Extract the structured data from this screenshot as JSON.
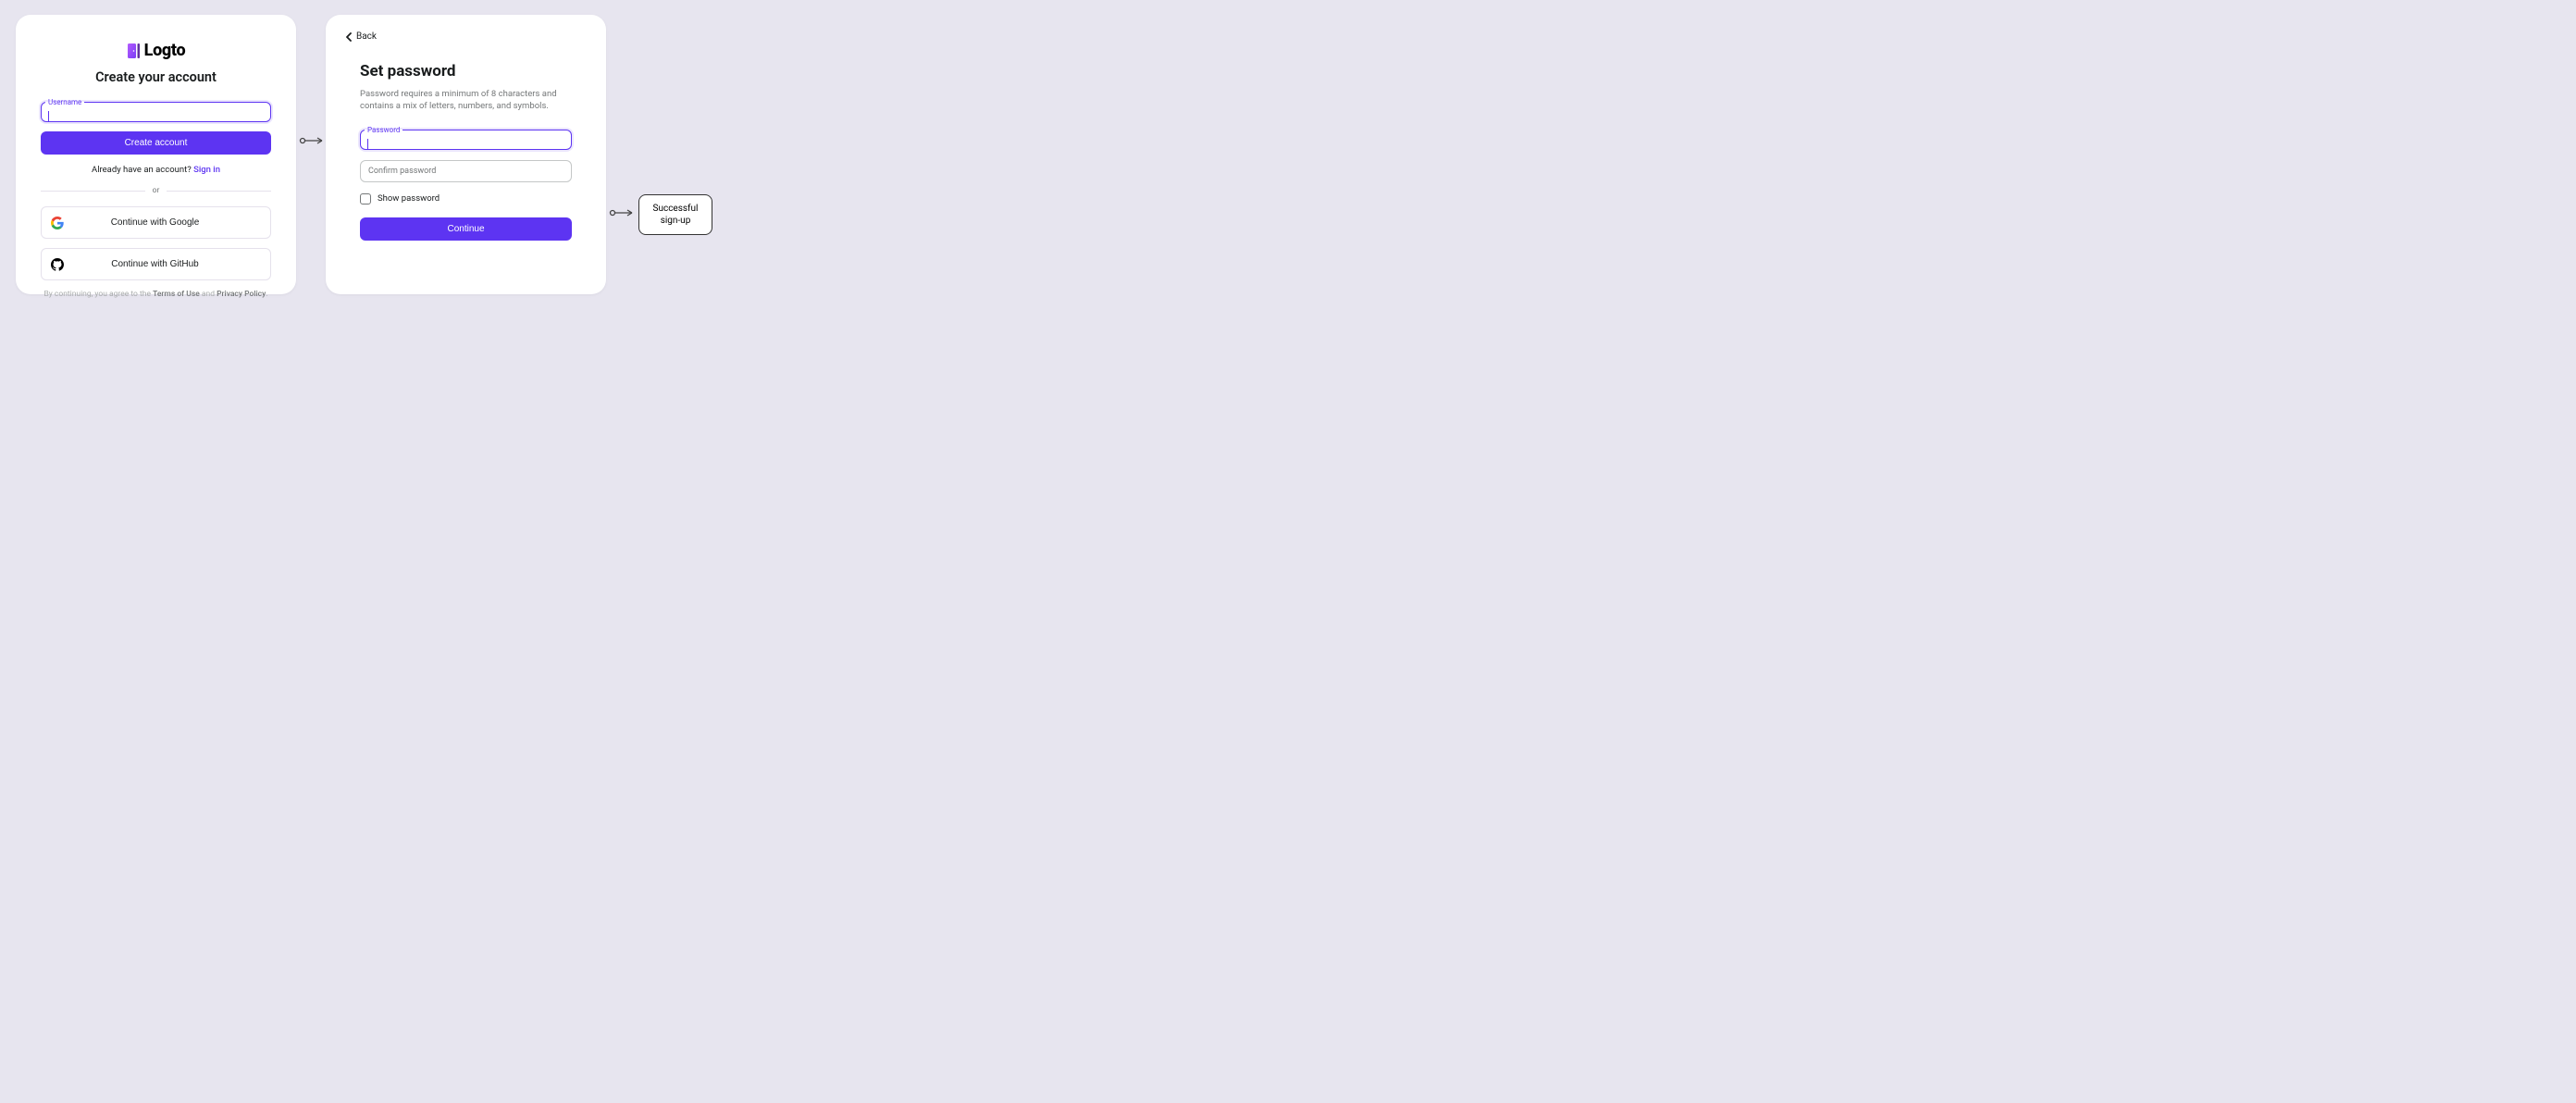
{
  "card1": {
    "brand": "Logto",
    "title": "Create your account",
    "username_label": "Username",
    "create_button": "Create account",
    "signin_prefix": "Already have an account? ",
    "signin_link": "Sign in",
    "divider": "or",
    "google_button": "Continue with Google",
    "github_button": "Continue with GitHub",
    "terms_prefix": "By continuing, you agree to the ",
    "terms_link": "Terms of Use",
    "terms_mid": " and ",
    "privacy_link": "Privacy Policy",
    "terms_suffix": "."
  },
  "card2": {
    "back": "Back",
    "title": "Set password",
    "description": "Password requires a minimum of 8 characters and contains a mix of letters, numbers, and symbols.",
    "password_label": "Password",
    "confirm_placeholder": "Confirm password",
    "show_password": "Show password",
    "continue_button": "Continue"
  },
  "callout": {
    "line1": "Successful",
    "line2": "sign-up"
  }
}
